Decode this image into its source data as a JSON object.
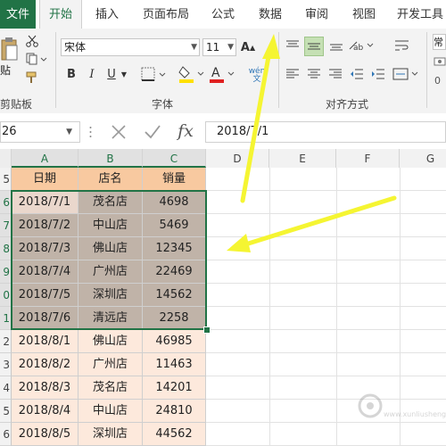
{
  "ribbon": {
    "tabs": [
      {
        "label": "文件"
      },
      {
        "label": "开始"
      },
      {
        "label": "插入"
      },
      {
        "label": "页面布局"
      },
      {
        "label": "公式"
      },
      {
        "label": "数据"
      },
      {
        "label": "审阅"
      },
      {
        "label": "视图"
      },
      {
        "label": "开发工具"
      }
    ],
    "clipboard": {
      "paste_label": "贴",
      "group_label": "剪贴板"
    },
    "font": {
      "name": "宋体",
      "size": "11",
      "group_label": "字体",
      "bold": "B",
      "italic": "I",
      "underline": "U",
      "grow": "A",
      "font_color_letter": "A",
      "font_color": "#e02020",
      "fill_color": "#ffe000"
    },
    "alignment": {
      "group_label": "对齐方式",
      "wen": "wén",
      "wen2": "文"
    },
    "number": {
      "label": "常",
      "sub": "0"
    }
  },
  "formula_bar": {
    "name_box": "26",
    "fx": "fx",
    "value": "2018/7/1"
  },
  "sheet": {
    "columns": [
      "A",
      "B",
      "C",
      "D",
      "E",
      "F",
      "G"
    ],
    "header": {
      "date": "日期",
      "store": "店名",
      "qty": "销量"
    },
    "row_numbers": [
      "5",
      "6",
      "7",
      "8",
      "9",
      "0",
      "1",
      "2",
      "3",
      "4",
      "5",
      "6"
    ],
    "rows": [
      {
        "date": "2018/7/1",
        "store": "茂名店",
        "qty": "4698"
      },
      {
        "date": "2018/7/2",
        "store": "中山店",
        "qty": "5469"
      },
      {
        "date": "2018/7/3",
        "store": "佛山店",
        "qty": "12345"
      },
      {
        "date": "2018/7/4",
        "store": "广州店",
        "qty": "22469"
      },
      {
        "date": "2018/7/5",
        "store": "深圳店",
        "qty": "14562"
      },
      {
        "date": "2018/7/6",
        "store": "清远店",
        "qty": "2258"
      },
      {
        "date": "2018/8/1",
        "store": "佛山店",
        "qty": "46985"
      },
      {
        "date": "2018/8/2",
        "store": "广州店",
        "qty": "11463"
      },
      {
        "date": "2018/8/3",
        "store": "茂名店",
        "qty": "14201"
      },
      {
        "date": "2018/8/4",
        "store": "中山店",
        "qty": "24810"
      },
      {
        "date": "2018/8/5",
        "store": "深圳店",
        "qty": "44562"
      }
    ],
    "colors": {
      "header_fill": "#f8c9a0",
      "selected_a": "#ead7cc",
      "selected_bc": "#c0b3a8",
      "normal_fill": "#fde9dc",
      "selection_border": "#217346"
    }
  },
  "annotation": {
    "arrow_color": "#f5f532"
  },
  "watermark": {
    "text": "www.xunliusheng.com"
  }
}
